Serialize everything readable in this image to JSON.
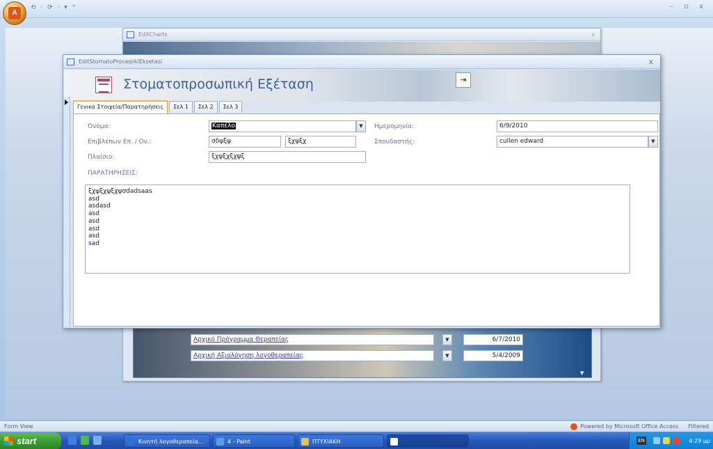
{
  "app": {
    "quick_access": "⟲ · ⟳ · ▾ ⁼",
    "window_controls": "–  ▫  x"
  },
  "background_form": {
    "title": "EditCharts",
    "close": "x",
    "rows": [
      {
        "link": "Αρχικό Πρόγραμμα Θεραπείας",
        "date": "6/7/2010"
      },
      {
        "link": "Αρχική Αξιολόγηση λογοθεραπείας",
        "date": "5/4/2009"
      }
    ]
  },
  "form": {
    "window_title": "EditStomatoProswpikiEksetasi",
    "close": "x",
    "heading": "Στοματοπροσωπική Εξέταση",
    "exit_glyph": "⇥",
    "tabs": [
      "Γενικα Στοιχεία/Παρατηρήσεις",
      "Σελ 1",
      "Σελ 2",
      "Σελ 3"
    ],
    "fields": {
      "name_label": "Όνομα:",
      "name_value": "Καπέλο",
      "date_label": "Ημερομηνία:",
      "date_value": "6/9/2010",
      "supervisor_label": "Επιβλέπων Επ. / Ον.:",
      "supervisor_first": "σδψξψ",
      "supervisor_last": "ξχψξχ",
      "student_label": "Σπουδαστής:",
      "student_value": "cullen edward",
      "context_label": "Πλαίσιο:",
      "context_value": "ξχψξχξχψξ",
      "notes_label": "ΠΑΡΑΤΗΡΗΣΕΙΣ:"
    },
    "notes": [
      "ξχψξχψξχψσdadsaas",
      "asd",
      "asdasd",
      "asd",
      "asd",
      "asd",
      "asd",
      "sad"
    ]
  },
  "status_bar": {
    "left": "Form View",
    "powered": "Powered by Microsoft Office Access",
    "filtered": "Filtered"
  },
  "taskbar": {
    "start": "start",
    "tasks": [
      {
        "label": "Κινητή λογοθεραπεία...",
        "color": "#2f6fd8"
      },
      {
        "label": "4 - Paint",
        "color": "#5aa0e6"
      },
      {
        "label": "ΠΤΥΧΙΑΚΗ",
        "color": "#e8c34a"
      },
      {
        "label": "",
        "color": "#ffffff"
      }
    ],
    "lang": "EN",
    "clock": "4:29 μμ"
  },
  "colors": {
    "accent_tab": "#f0b451",
    "label_text": "#6d6bb1",
    "title_text": "#3c5f96"
  }
}
